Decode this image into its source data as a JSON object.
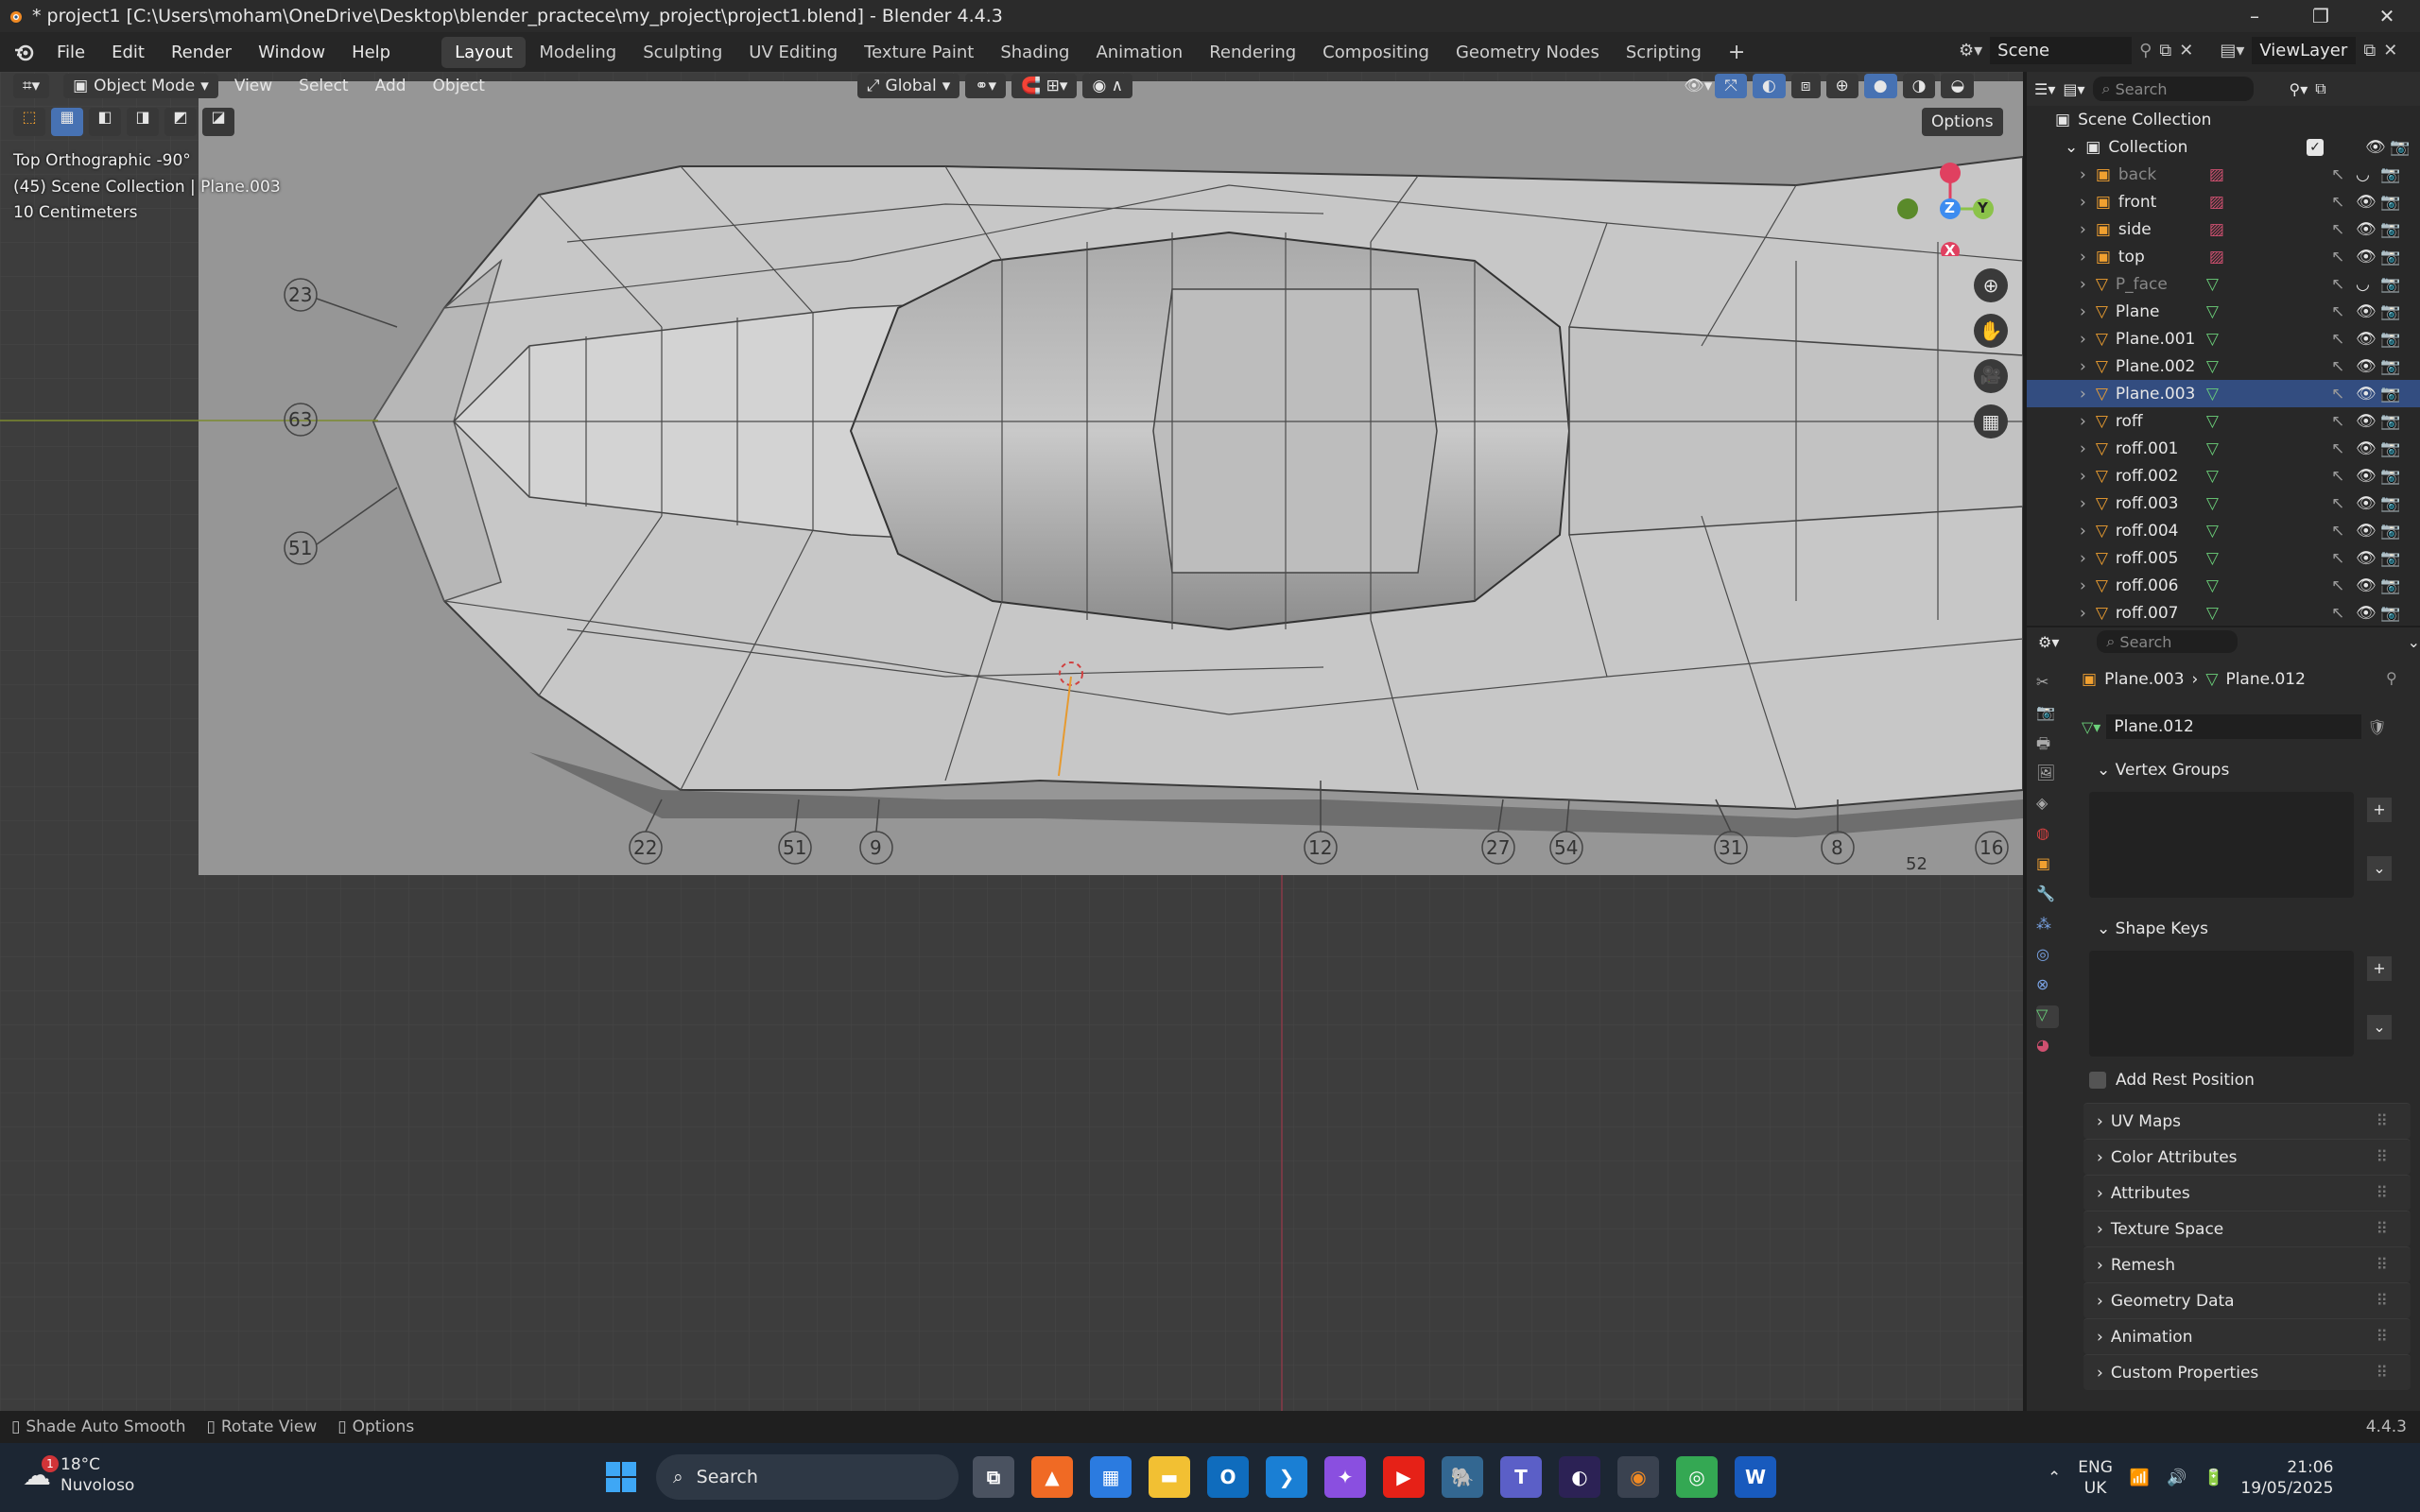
{
  "window": {
    "title": "* project1 [C:\\Users\\moham\\OneDrive\\Desktop\\blender_practece\\my_project\\project1.blend] - Blender 4.4.3"
  },
  "menus": [
    "File",
    "Edit",
    "Render",
    "Window",
    "Help"
  ],
  "workspaces": [
    "Layout",
    "Modeling",
    "Sculpting",
    "UV Editing",
    "Texture Paint",
    "Shading",
    "Animation",
    "Rendering",
    "Compositing",
    "Geometry Nodes",
    "Scripting"
  ],
  "scene": {
    "name": "Scene",
    "view_layer": "ViewLayer"
  },
  "viewport_header": {
    "mode": "Object Mode",
    "menus": [
      "View",
      "Select",
      "Add",
      "Object"
    ],
    "transform": "Global",
    "options": "Options"
  },
  "viewport_overlay": {
    "view_name": "Top Orthographic -90°",
    "collection": "(45) Scene Collection | Plane.003",
    "scale": "10 Centimeters"
  },
  "blueprint_numbers": [
    "23",
    "63",
    "51",
    "22",
    "51",
    "9",
    "12",
    "27",
    "54",
    "31",
    "8",
    "16",
    "52"
  ],
  "gizmo": {
    "z": "Z",
    "y": "Y",
    "x": "X"
  },
  "outliner": {
    "search_placeholder": "Search",
    "root": "Scene Collection",
    "collection": "Collection",
    "items": [
      {
        "name": "back",
        "dim": true
      },
      {
        "name": "front",
        "dim": false
      },
      {
        "name": "side",
        "dim": false
      },
      {
        "name": "top",
        "dim": false
      },
      {
        "name": "P_face",
        "dim": true
      },
      {
        "name": "Plane",
        "dim": false
      },
      {
        "name": "Plane.001",
        "dim": false
      },
      {
        "name": "Plane.002",
        "dim": false
      },
      {
        "name": "Plane.003",
        "dim": false,
        "selected": true
      },
      {
        "name": "roff",
        "dim": false
      },
      {
        "name": "roff.001",
        "dim": false
      },
      {
        "name": "roff.002",
        "dim": false
      },
      {
        "name": "roff.003",
        "dim": false
      },
      {
        "name": "roff.004",
        "dim": false
      },
      {
        "name": "roff.005",
        "dim": false
      },
      {
        "name": "roff.006",
        "dim": false
      },
      {
        "name": "roff.007",
        "dim": false
      }
    ]
  },
  "properties": {
    "search_placeholder": "Search",
    "breadcrumb_object": "Plane.003",
    "breadcrumb_mesh": "Plane.012",
    "mesh_name": "Plane.012",
    "panels_open": [
      "Vertex Groups",
      "Shape Keys"
    ],
    "add_rest_position": "Add Rest Position",
    "panels_closed": [
      "UV Maps",
      "Color Attributes",
      "Attributes",
      "Texture Space",
      "Remesh",
      "Geometry Data",
      "Animation",
      "Custom Properties"
    ]
  },
  "statusbar": {
    "items": [
      "Shade Auto Smooth",
      "Rotate View",
      "Options"
    ],
    "version": "4.4.3"
  },
  "taskbar": {
    "weather_temp": "18°C",
    "weather_desc": "Nuvoloso",
    "weather_badge": "1",
    "search": "Search",
    "lang1": "ENG",
    "lang2": "UK",
    "time": "21:06",
    "date": "19/05/2025"
  },
  "colors": {
    "accent_orange": "#f0a030",
    "selected_row": "#334d80",
    "mesh_green": "#6bd07a",
    "wrench_blue": "#7aa4e6",
    "axis_red": "#e04060",
    "axis_green": "#8bc34a",
    "axis_blue": "#3d8cf0"
  }
}
